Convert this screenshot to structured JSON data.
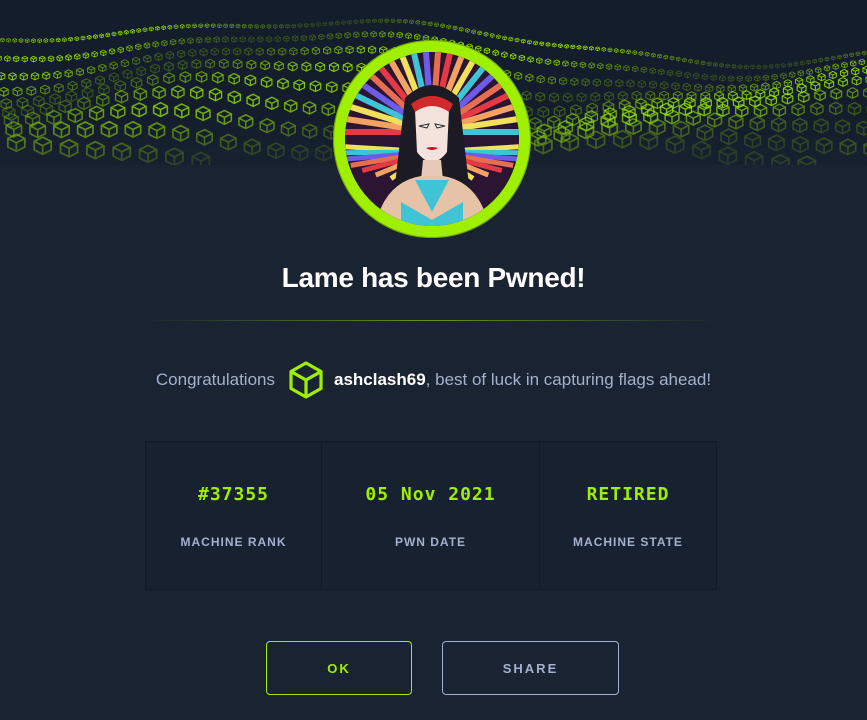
{
  "banner": {
    "accent_color": "#9fef00"
  },
  "avatar": {
    "machine_name": "Lame"
  },
  "title": "Lame has been Pwned!",
  "congrats": {
    "prefix": "Congratulations",
    "icon": "htb-cube-icon",
    "username": "ashclash69",
    "suffix": ", best of luck in capturing flags ahead!"
  },
  "stats": [
    {
      "value": "#37355",
      "label": "MACHINE RANK"
    },
    {
      "value": "05 Nov 2021",
      "label": "PWN DATE"
    },
    {
      "value": "RETIRED",
      "label": "MACHINE STATE"
    }
  ],
  "buttons": {
    "ok_label": "OK",
    "share_label": "SHARE"
  },
  "colors": {
    "background": "#1a2332",
    "accent": "#9fef00",
    "muted": "#a4b1cd"
  }
}
